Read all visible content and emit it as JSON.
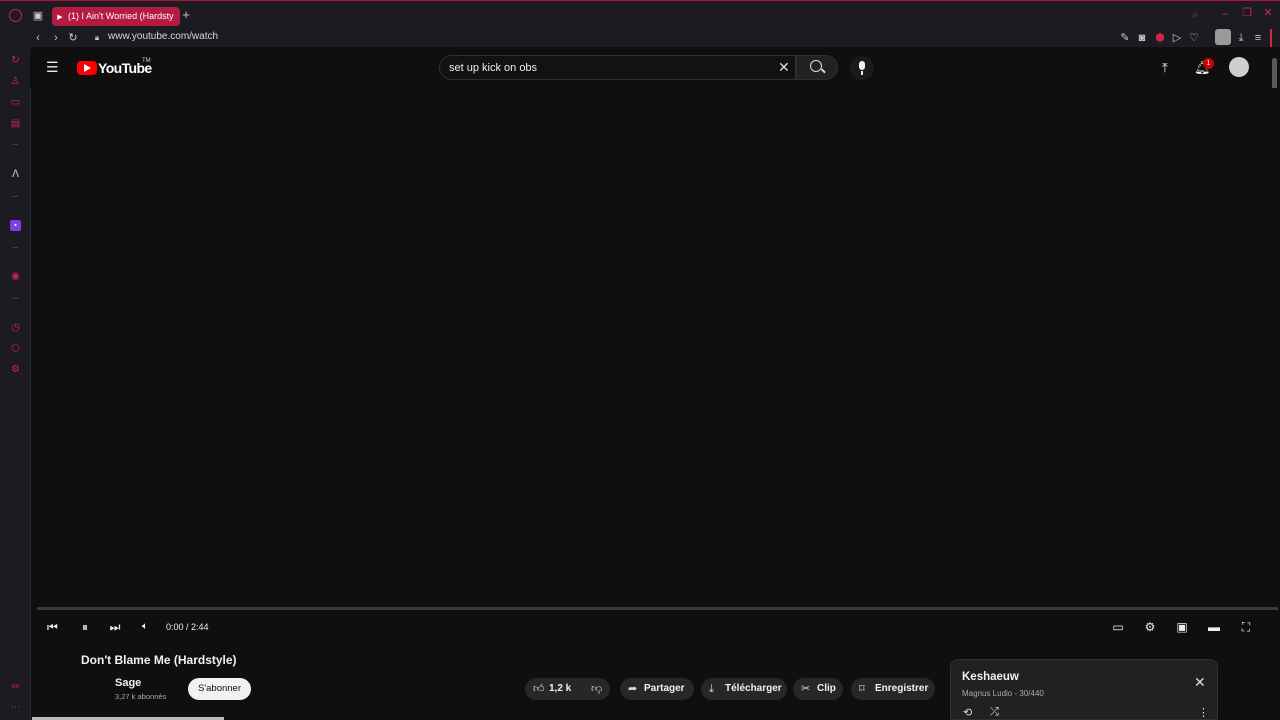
{
  "browser": {
    "tab_title": "(1) I Ain't Worried (Hardsty",
    "new_tab": "+",
    "url": "www.youtube.com/watch",
    "accent": "#b51a41"
  },
  "youtube": {
    "logo": "YouTube",
    "logo_mark": "TM",
    "search_value": "set up kick on obs",
    "notifications_count": "1"
  },
  "player": {
    "time": "0:00 / 2:44",
    "progress": 0
  },
  "video": {
    "title": "Don't Blame Me (Hardstyle)",
    "channel": "Sage",
    "subscribers": "3,27 k abonnés",
    "subscribe_label": "S'abonner",
    "likes": "1,2 k",
    "share_label": "Partager",
    "download_label": "Télécharger",
    "clip_label": "Clip",
    "save_label": "Enregistrer"
  },
  "playlist": {
    "title": "Keshaeuw",
    "subtitle": "Magnus Ludio - 30/440"
  },
  "sidebar_footer": "ox"
}
